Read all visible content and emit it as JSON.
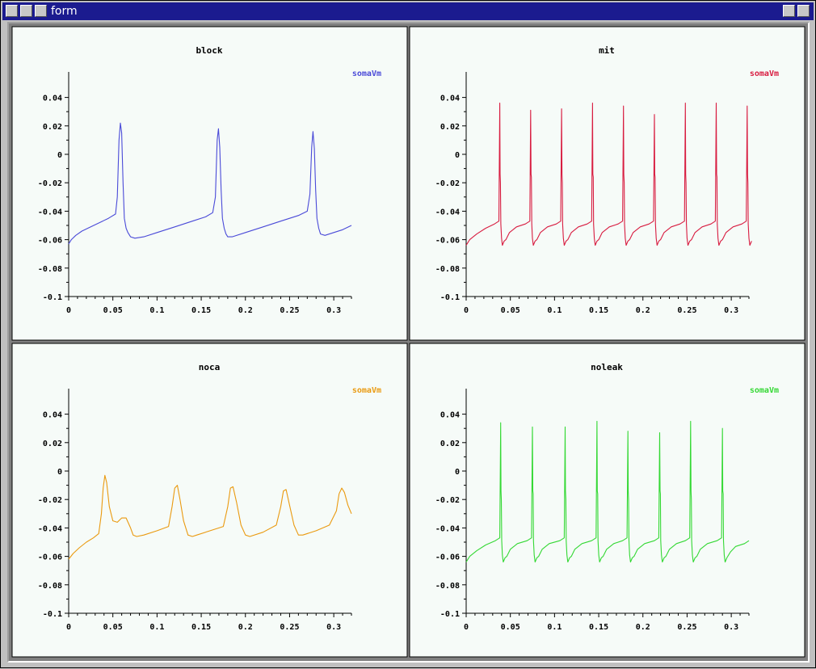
{
  "window": {
    "title": "form"
  },
  "colors": {
    "titlebar": "#1b1b8f",
    "panel_bg": "#f6fbf8",
    "block": "#4a4ad8",
    "mit": "#d81c40",
    "noca": "#ea9a10",
    "noleak": "#34d834"
  },
  "chart_data": [
    {
      "type": "line",
      "title": "block",
      "series_name": "somaVm",
      "color": "#4a4ad8",
      "xlim": [
        0,
        0.32
      ],
      "ylim": [
        -0.1,
        0.05
      ],
      "xticks": [
        0,
        0.05,
        0.1,
        0.15,
        0.2,
        0.25,
        0.3
      ],
      "xticklabels": [
        "0",
        "0.05",
        "0.1",
        "0.15",
        "0.2",
        "0.25",
        "0.3"
      ],
      "yticks": [
        0.04,
        0.02,
        0,
        -0.02,
        -0.04,
        -0.06,
        -0.08,
        -0.1
      ],
      "yticklabels": [
        "0.04",
        "0.02",
        "0",
        "-0.02",
        "-0.04",
        "-0.06",
        "-0.08",
        "-0.1"
      ],
      "series": [
        {
          "name": "somaVm",
          "x": [
            0,
            0.003,
            0.008,
            0.015,
            0.025,
            0.035,
            0.045,
            0.053,
            0.055,
            0.057,
            0.0585,
            0.06,
            0.0615,
            0.063,
            0.065,
            0.067,
            0.07,
            0.075,
            0.085,
            0.1,
            0.12,
            0.14,
            0.155,
            0.163,
            0.166,
            0.168,
            0.1695,
            0.171,
            0.1725,
            0.174,
            0.176,
            0.178,
            0.18,
            0.185,
            0.2,
            0.22,
            0.24,
            0.26,
            0.27,
            0.273,
            0.275,
            0.2765,
            0.278,
            0.2795,
            0.281,
            0.283,
            0.285,
            0.29,
            0.3,
            0.31,
            0.32
          ],
          "y": [
            -0.063,
            -0.06,
            -0.057,
            -0.054,
            -0.051,
            -0.048,
            -0.045,
            -0.042,
            -0.03,
            0.01,
            0.022,
            0.015,
            -0.02,
            -0.045,
            -0.052,
            -0.055,
            -0.058,
            -0.059,
            -0.058,
            -0.055,
            -0.051,
            -0.047,
            -0.044,
            -0.041,
            -0.03,
            0.01,
            0.018,
            0.005,
            -0.025,
            -0.045,
            -0.052,
            -0.056,
            -0.058,
            -0.058,
            -0.055,
            -0.051,
            -0.047,
            -0.043,
            -0.04,
            -0.028,
            0.005,
            0.016,
            0.004,
            -0.025,
            -0.045,
            -0.052,
            -0.056,
            -0.057,
            -0.055,
            -0.053,
            -0.05
          ]
        }
      ]
    },
    {
      "type": "line",
      "title": "mit",
      "series_name": "somaVm",
      "color": "#d81c40",
      "xlim": [
        0,
        0.32
      ],
      "ylim": [
        -0.1,
        0.05
      ],
      "xticks": [
        0,
        0.05,
        0.1,
        0.15,
        0.2,
        0.25,
        0.3
      ],
      "xticklabels": [
        "0",
        "0.05",
        "0.1",
        "0.15",
        "0.2",
        "0.25",
        "0.3"
      ],
      "yticks": [
        0.04,
        0.02,
        0,
        -0.02,
        -0.04,
        -0.06,
        -0.08,
        -0.1
      ],
      "yticklabels": [
        "0.04",
        "0.02",
        "0",
        "-0.02",
        "-0.04",
        "-0.06",
        "-0.08",
        "-0.1"
      ],
      "series": [
        {
          "name": "somaVm",
          "spikes": [
            0.038,
            0.073,
            0.108,
            0.143,
            0.178,
            0.213,
            0.248,
            0.283,
            0.318
          ],
          "peaks": [
            0.036,
            0.031,
            0.032,
            0.036,
            0.034,
            0.028,
            0.036,
            0.036,
            0.034
          ],
          "rest": -0.064
        }
      ]
    },
    {
      "type": "line",
      "title": "noca",
      "series_name": "somaVm",
      "color": "#ea9a10",
      "xlim": [
        0,
        0.32
      ],
      "ylim": [
        -0.1,
        0.05
      ],
      "xticks": [
        0,
        0.05,
        0.1,
        0.15,
        0.2,
        0.25,
        0.3
      ],
      "xticklabels": [
        "0",
        "0.05",
        "0.1",
        "0.15",
        "0.2",
        "0.25",
        "0.3"
      ],
      "yticks": [
        0.04,
        0.02,
        0,
        -0.02,
        -0.04,
        -0.06,
        -0.08,
        -0.1
      ],
      "yticklabels": [
        "0.04",
        "0.02",
        "0",
        "-0.02",
        "-0.04",
        "-0.06",
        "-0.08",
        "-0.1"
      ],
      "series": [
        {
          "name": "somaVm",
          "x": [
            0,
            0.005,
            0.012,
            0.02,
            0.028,
            0.034,
            0.037,
            0.039,
            0.041,
            0.043,
            0.046,
            0.05,
            0.055,
            0.06,
            0.065,
            0.07,
            0.073,
            0.077,
            0.085,
            0.1,
            0.113,
            0.117,
            0.12,
            0.123,
            0.126,
            0.13,
            0.135,
            0.14,
            0.145,
            0.16,
            0.175,
            0.18,
            0.183,
            0.186,
            0.19,
            0.195,
            0.2,
            0.205,
            0.22,
            0.235,
            0.24,
            0.243,
            0.246,
            0.25,
            0.255,
            0.26,
            0.265,
            0.28,
            0.295,
            0.303,
            0.306,
            0.309,
            0.312,
            0.316,
            0.32
          ],
          "y": [
            -0.062,
            -0.058,
            -0.054,
            -0.05,
            -0.047,
            -0.044,
            -0.03,
            -0.012,
            -0.003,
            -0.008,
            -0.025,
            -0.035,
            -0.036,
            -0.033,
            -0.033,
            -0.04,
            -0.045,
            -0.046,
            -0.045,
            -0.042,
            -0.039,
            -0.025,
            -0.012,
            -0.01,
            -0.02,
            -0.035,
            -0.045,
            -0.046,
            -0.045,
            -0.042,
            -0.039,
            -0.025,
            -0.012,
            -0.011,
            -0.022,
            -0.038,
            -0.045,
            -0.046,
            -0.043,
            -0.038,
            -0.025,
            -0.014,
            -0.013,
            -0.024,
            -0.038,
            -0.045,
            -0.045,
            -0.042,
            -0.038,
            -0.028,
            -0.016,
            -0.012,
            -0.015,
            -0.024,
            -0.03
          ]
        }
      ]
    },
    {
      "type": "line",
      "title": "noleak",
      "series_name": "somaVm",
      "color": "#34d834",
      "xlim": [
        0,
        0.32
      ],
      "ylim": [
        -0.1,
        0.05
      ],
      "xticks": [
        0,
        0.05,
        0.1,
        0.15,
        0.2,
        0.25,
        0.3
      ],
      "xticklabels": [
        "0",
        "0.05",
        "0.1",
        "0.15",
        "0.2",
        "0.25",
        "0.3"
      ],
      "yticks": [
        0.04,
        0.02,
        0,
        -0.02,
        -0.04,
        -0.06,
        -0.08,
        -0.1
      ],
      "yticklabels": [
        "0.04",
        "0.02",
        "0",
        "-0.02",
        "-0.04",
        "-0.06",
        "-0.08",
        "-0.1"
      ],
      "series": [
        {
          "name": "somaVm",
          "spikes": [
            0.039,
            0.075,
            0.112,
            0.148,
            0.183,
            0.219,
            0.254,
            0.29
          ],
          "peaks": [
            0.034,
            0.031,
            0.031,
            0.035,
            0.028,
            0.027,
            0.035,
            0.03
          ],
          "rest": -0.064,
          "end_x": 0.32,
          "end_y": -0.049
        }
      ]
    }
  ]
}
